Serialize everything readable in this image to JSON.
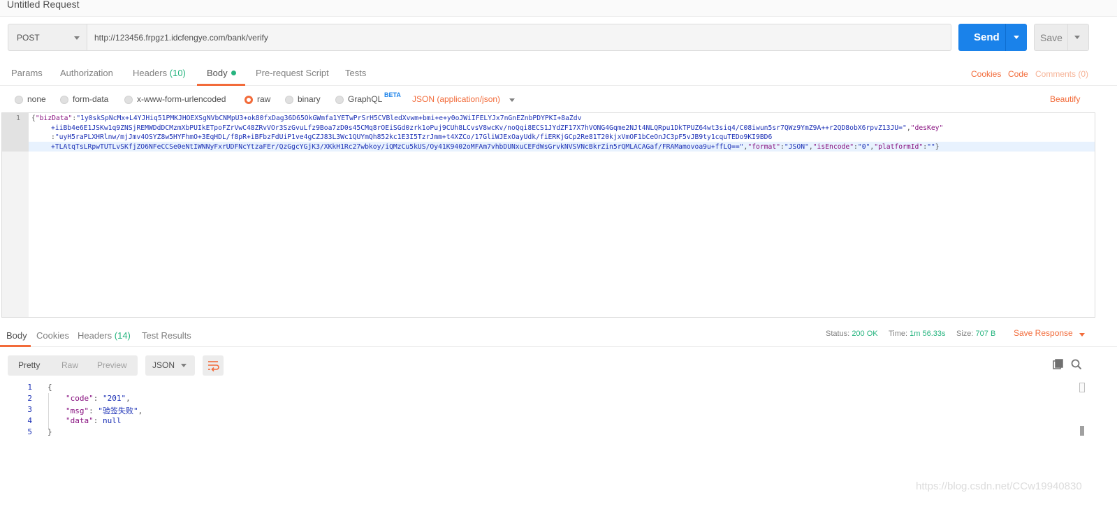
{
  "window": {
    "title": "Untitled Request"
  },
  "request": {
    "method": "POST",
    "url": "http://123456.frpgz1.idcfengye.com/bank/verify",
    "send_label": "Send",
    "save_label": "Save"
  },
  "request_tabs": [
    {
      "label": "Params"
    },
    {
      "label": "Authorization"
    },
    {
      "label": "Headers",
      "count": "(10)"
    },
    {
      "label": "Body",
      "active": true
    },
    {
      "label": "Pre-request Script"
    },
    {
      "label": "Tests"
    }
  ],
  "right_links": {
    "cookies": "Cookies",
    "code": "Code",
    "comments": "Comments (0)"
  },
  "body_types": {
    "none": "none",
    "form_data": "form-data",
    "urlencoded": "x-www-form-urlencoded",
    "raw": "raw",
    "binary": "binary",
    "graphql": "GraphQL",
    "beta": "BETA",
    "selected": "raw",
    "content_type": "JSON (application/json)",
    "beautify": "Beautify"
  },
  "editor": {
    "line_number": "1",
    "segments": [
      {
        "kind": "p",
        "text": "{"
      },
      {
        "kind": "k",
        "text": "\"bizData\""
      },
      {
        "kind": "p",
        "text": ":"
      },
      {
        "kind": "v",
        "text": "\"1y0skSpNcMx+L4YJHiq51PMKJHOEXSgNVbCNMpU3+ok80fxDag36D65OkGWmfa1YETwPrSrH5CVBledXvwm+bmi+e+y0oJWiIFELYJx7nGnEZnbPDYPKI+8aZdv"
      },
      {
        "kind": "v",
        "text": "+iiBb4e6E1JSKw1q9ZNSjREMWDdDCMzmXbPUIkETpoFZrVwC48ZRvVOr3SzGvuLfz9Boa7zD0s45CMq8rOEiSGd0zrk1oPuj9CUh8LCvsV8wcKv/noQqi8ECS1JYdZF17X7hVONG4Gqme2NJt4NLQRpu1DkTPUZ64wt3siq4/C08iwun5sr7QWz9YmZ9A++r2QD8obX6rpvZ13JU=\""
      },
      {
        "kind": "p",
        "text": ","
      },
      {
        "kind": "k",
        "text": "\"desKey\""
      },
      {
        "kind": "p",
        "text": ":"
      },
      {
        "kind": "v",
        "text": "\"uyH5raPLXHRlnw/mjJmv4OSYZ8w5HYFhmO+3EqHDL/f8pR+iBFbzFdUiP1ve4gCZJ83L3Wc1QUYmQh852kc1E3I5TzrJmm+t4XZCo/17GliWJExOayUdk/fiERKjGCp2Re81T20kjxVmOF1bCeOnJC3pF5vJB9ty1cquTEDo9KI9BD6"
      },
      {
        "kind": "v",
        "text": "+TLAtqTsLRpwTUTLvSKfjZO6NFeCCSe0eNtIWNNyFxrUDFNcYtzaFEr/QzGgcYGjK3/XKkH1Rc27wbkoy/iQMzCu5kUS/Oy41K9402oMFAm7vhbDUNxuCEFdWsGrvkNVSVNcBkrZin5rQMLACAGaf/FRAMamovoa9u+ffLQ==\""
      },
      {
        "kind": "p",
        "text": ","
      },
      {
        "kind": "k",
        "text": "\"format\""
      },
      {
        "kind": "p",
        "text": ":"
      },
      {
        "kind": "v",
        "text": "\"JSON\""
      },
      {
        "kind": "p",
        "text": ","
      },
      {
        "kind": "k",
        "text": "\"isEncode\""
      },
      {
        "kind": "p",
        "text": ":"
      },
      {
        "kind": "v",
        "text": "\"0\""
      },
      {
        "kind": "p",
        "text": ","
      },
      {
        "kind": "k",
        "text": "\"platformId\""
      },
      {
        "kind": "p",
        "text": ":"
      },
      {
        "kind": "v",
        "text": "\"\""
      },
      {
        "kind": "p",
        "text": "}"
      }
    ]
  },
  "response_tabs": [
    {
      "label": "Body",
      "active": true
    },
    {
      "label": "Cookies"
    },
    {
      "label": "Headers",
      "count": "(14)"
    },
    {
      "label": "Test Results"
    }
  ],
  "response_status": {
    "status_label": "Status:",
    "status": "200 OK",
    "time_label": "Time:",
    "time": "1m 56.33s",
    "size_label": "Size:",
    "size": "707 B",
    "save_response": "Save Response"
  },
  "response_view": {
    "modes": [
      "Pretty",
      "Raw",
      "Preview"
    ],
    "selected_mode": "Pretty",
    "format": "JSON"
  },
  "response_body": {
    "line_numbers": [
      "1",
      "2",
      "3",
      "4",
      "5"
    ],
    "lines": [
      {
        "parts": [
          {
            "c": "p",
            "t": "{"
          }
        ]
      },
      {
        "parts": [
          {
            "c": "k",
            "t": "\"code\""
          },
          {
            "c": "p",
            "t": ": "
          },
          {
            "c": "s",
            "t": "\"201\""
          },
          {
            "c": "p",
            "t": ","
          }
        ]
      },
      {
        "parts": [
          {
            "c": "k",
            "t": "\"msg\""
          },
          {
            "c": "p",
            "t": ": "
          },
          {
            "c": "s",
            "t": "\"验签失败\""
          },
          {
            "c": "p",
            "t": ","
          }
        ]
      },
      {
        "parts": [
          {
            "c": "k",
            "t": "\"data\""
          },
          {
            "c": "p",
            "t": ": "
          },
          {
            "c": "n",
            "t": "null"
          }
        ]
      },
      {
        "parts": [
          {
            "c": "p",
            "t": "}"
          }
        ]
      }
    ]
  },
  "watermark": "https://blog.csdn.net/CCw19940830",
  "colors": {
    "accent": "#f26b3a",
    "send": "#1a82ea",
    "ok": "#26b47f"
  }
}
